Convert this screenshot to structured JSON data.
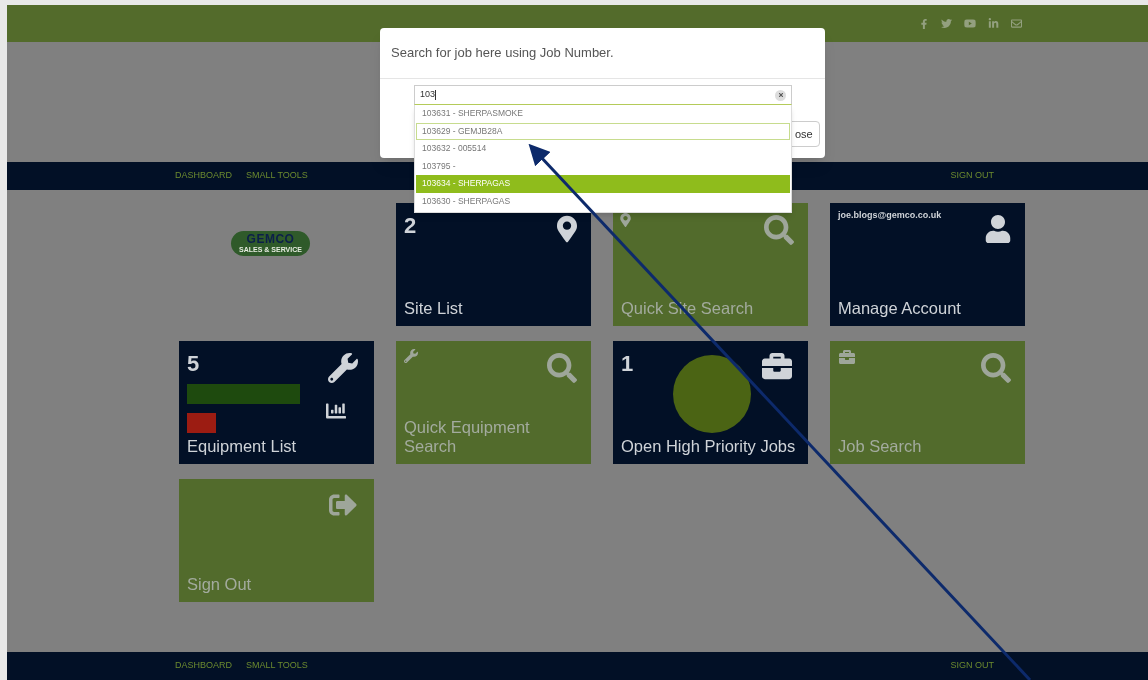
{
  "nav": {
    "links": [
      "DASHBOARD",
      "SMALL TOOLS"
    ],
    "sign_out": "SIGN OUT"
  },
  "logo": {
    "name": "GEMCO",
    "tagline": "SALES & SERVICE"
  },
  "tiles": [
    {
      "kind": "dark",
      "count": "2",
      "title": "Site List"
    },
    {
      "kind": "green",
      "title": "Quick Site Search"
    },
    {
      "kind": "dark",
      "email": "joe.blogs@gemco.co.uk",
      "title": "Manage Account"
    },
    {
      "kind": "dark",
      "count": "5",
      "title": "Equipment List"
    },
    {
      "kind": "green",
      "title": "Quick Equipment Search"
    },
    {
      "kind": "dark",
      "count": "1",
      "title": "Open High Priority Jobs"
    },
    {
      "kind": "green",
      "title": "Job Search"
    },
    {
      "kind": "green",
      "title": "Sign Out"
    }
  ],
  "footer_nav": {
    "links": [
      "DASHBOARD",
      "SMALL TOOLS"
    ],
    "sign_out": "SIGN OUT"
  },
  "modal": {
    "title": "Search for job here using Job Number.",
    "search": {
      "value": "103"
    },
    "results": [
      {
        "label": "103631 - SHERPASMOKE",
        "selected": false,
        "focused": false
      },
      {
        "label": "103629 - GEMJB28A",
        "selected": false,
        "focused": true
      },
      {
        "label": "103632 - 005514",
        "selected": false,
        "focused": false
      },
      {
        "label": "103795 -",
        "selected": false,
        "focused": false
      },
      {
        "label": "103634 - SHERPAGAS",
        "selected": true,
        "focused": false
      },
      {
        "label": "103630 - SHERPAGAS",
        "selected": false,
        "focused": false
      }
    ],
    "close_button": "ose"
  }
}
